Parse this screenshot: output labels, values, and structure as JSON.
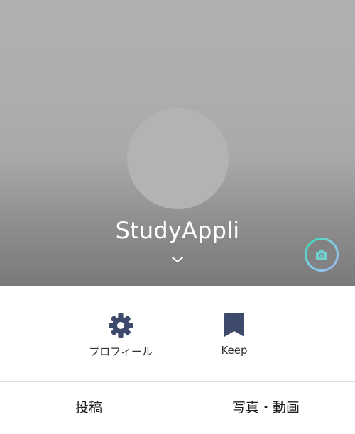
{
  "profile": {
    "name": "StudyAppli"
  },
  "actions": [
    {
      "label": "プロフィール",
      "icon": "gear-icon"
    },
    {
      "label": "Keep",
      "icon": "bookmark-icon"
    }
  ],
  "tabs": [
    {
      "label": "投稿"
    },
    {
      "label": "写真・動画"
    }
  ],
  "colors": {
    "icon": "#3d4a6b",
    "camera_ring_start": "#33d6a8",
    "camera_ring_end": "#9fb6f0",
    "camera_glyph": "#6fd0cf"
  }
}
